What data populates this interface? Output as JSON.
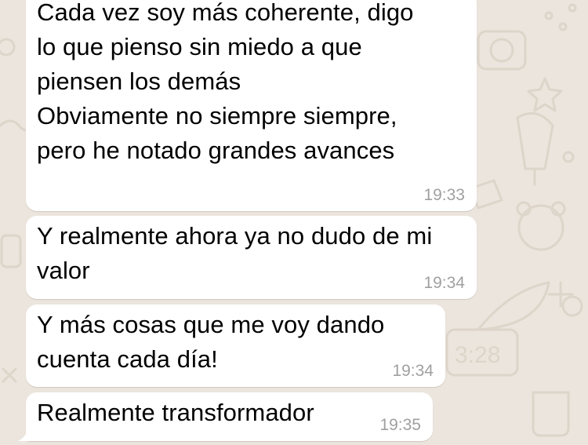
{
  "chat": {
    "messages": [
      {
        "text": "Cada vez soy más coherente, digo\nlo que pienso sin miedo a que\npiensen los demás\nObviamente no siempre siempre,\npero he notado grandes avances",
        "time": "19:33"
      },
      {
        "text": "Y realmente ahora ya no dudo de mi\nvalor",
        "time": "19:34"
      },
      {
        "text": "Y más cosas que me voy dando\ncuenta cada día!",
        "time": "19:34"
      },
      {
        "text": "Realmente transformador",
        "time": "19:35"
      }
    ]
  },
  "wallpaper": {
    "color": "#ece5dd",
    "doodle_color": "#ddd5c9",
    "clock_text": "3:28"
  },
  "bubble": {
    "color": "#ffffff",
    "timestamp_color": "#a0a0a0"
  }
}
